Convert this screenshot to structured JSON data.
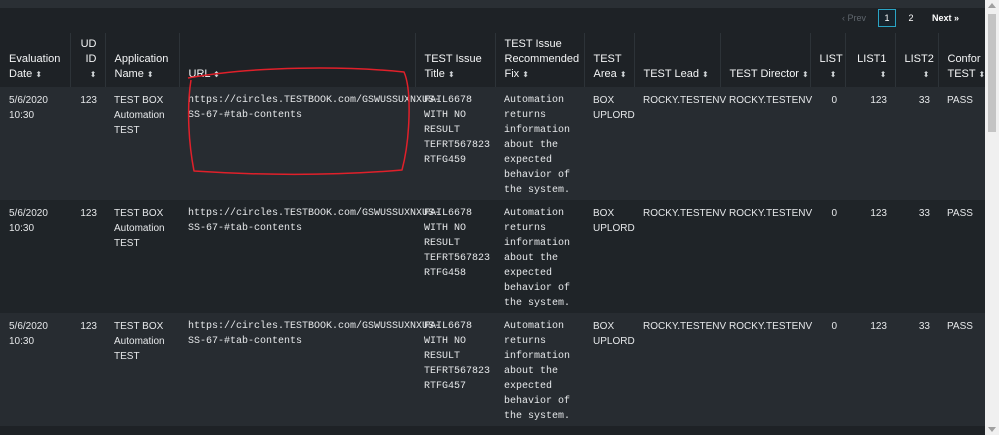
{
  "pagination": {
    "prev": "‹ Prev",
    "pages": [
      "1",
      "2"
    ],
    "next": "Next »"
  },
  "columns": [
    {
      "label": "Evaluation Date",
      "sort": "⬍"
    },
    {
      "label": "UD ID",
      "sort": "⬍"
    },
    {
      "label": "Application Name",
      "sort": "⬍"
    },
    {
      "label": "URL",
      "sort": "⬍"
    },
    {
      "label": "TEST Issue Title",
      "sort": "⬍"
    },
    {
      "label": "TEST Issue Recommended Fix",
      "sort": "⬍"
    },
    {
      "label": "TEST Area",
      "sort": "⬍"
    },
    {
      "label": "TEST Lead",
      "sort": "⬍"
    },
    {
      "label": "TEST Director",
      "sort": "⬍"
    },
    {
      "label": "LIST",
      "sort": "⬍"
    },
    {
      "label": "LIST1",
      "sort": "⬍"
    },
    {
      "label": "LIST2",
      "sort": "⬍"
    },
    {
      "label": "Confor TEST",
      "sort": "⬍"
    }
  ],
  "rows": [
    [
      "5/6/2020 10:30",
      "123",
      "TEST BOX Automation TEST",
      "https://circles.TESTBOOK.com/GSWUSSUXNXUS-SS-67-#tab-contents",
      "FAIL6678 WITH NO RESULT TEFRT567823 RTFG459",
      "Automation returns information about the expected behavior of the system.",
      "BOX UPLORD",
      "ROCKY.TESTENV",
      "ROCKY.TESTENV",
      "0",
      "123",
      "33",
      "PASS"
    ],
    [
      "5/6/2020 10:30",
      "123",
      "TEST BOX Automation TEST",
      "https://circles.TESTBOOK.com/GSWUSSUXNXUS-SS-67-#tab-contents",
      "FAIL6678 WITH NO RESULT TEFRT567823 RTFG458",
      "Automation returns information about the expected behavior of the system.",
      "BOX UPLORD",
      "ROCKY.TESTENV",
      "ROCKY.TESTENV",
      "0",
      "123",
      "33",
      "PASS"
    ],
    [
      "5/6/2020 10:30",
      "123",
      "TEST BOX Automation TEST",
      "https://circles.TESTBOOK.com/GSWUSSUXNXUS-SS-67-#tab-contents",
      "FAIL6678 WITH NO RESULT TEFRT567823 RTFG457",
      "Automation returns information about the expected behavior of the system.",
      "BOX UPLORD",
      "ROCKY.TESTENV",
      "ROCKY.TESTENV",
      "0",
      "123",
      "33",
      "PASS"
    ]
  ],
  "colors": {
    "background": "#1e2226",
    "row_odd": "#272c31",
    "row_even": "#1f2428",
    "active_page_border": "#2aa4c4",
    "annotation": "#e0202a"
  }
}
